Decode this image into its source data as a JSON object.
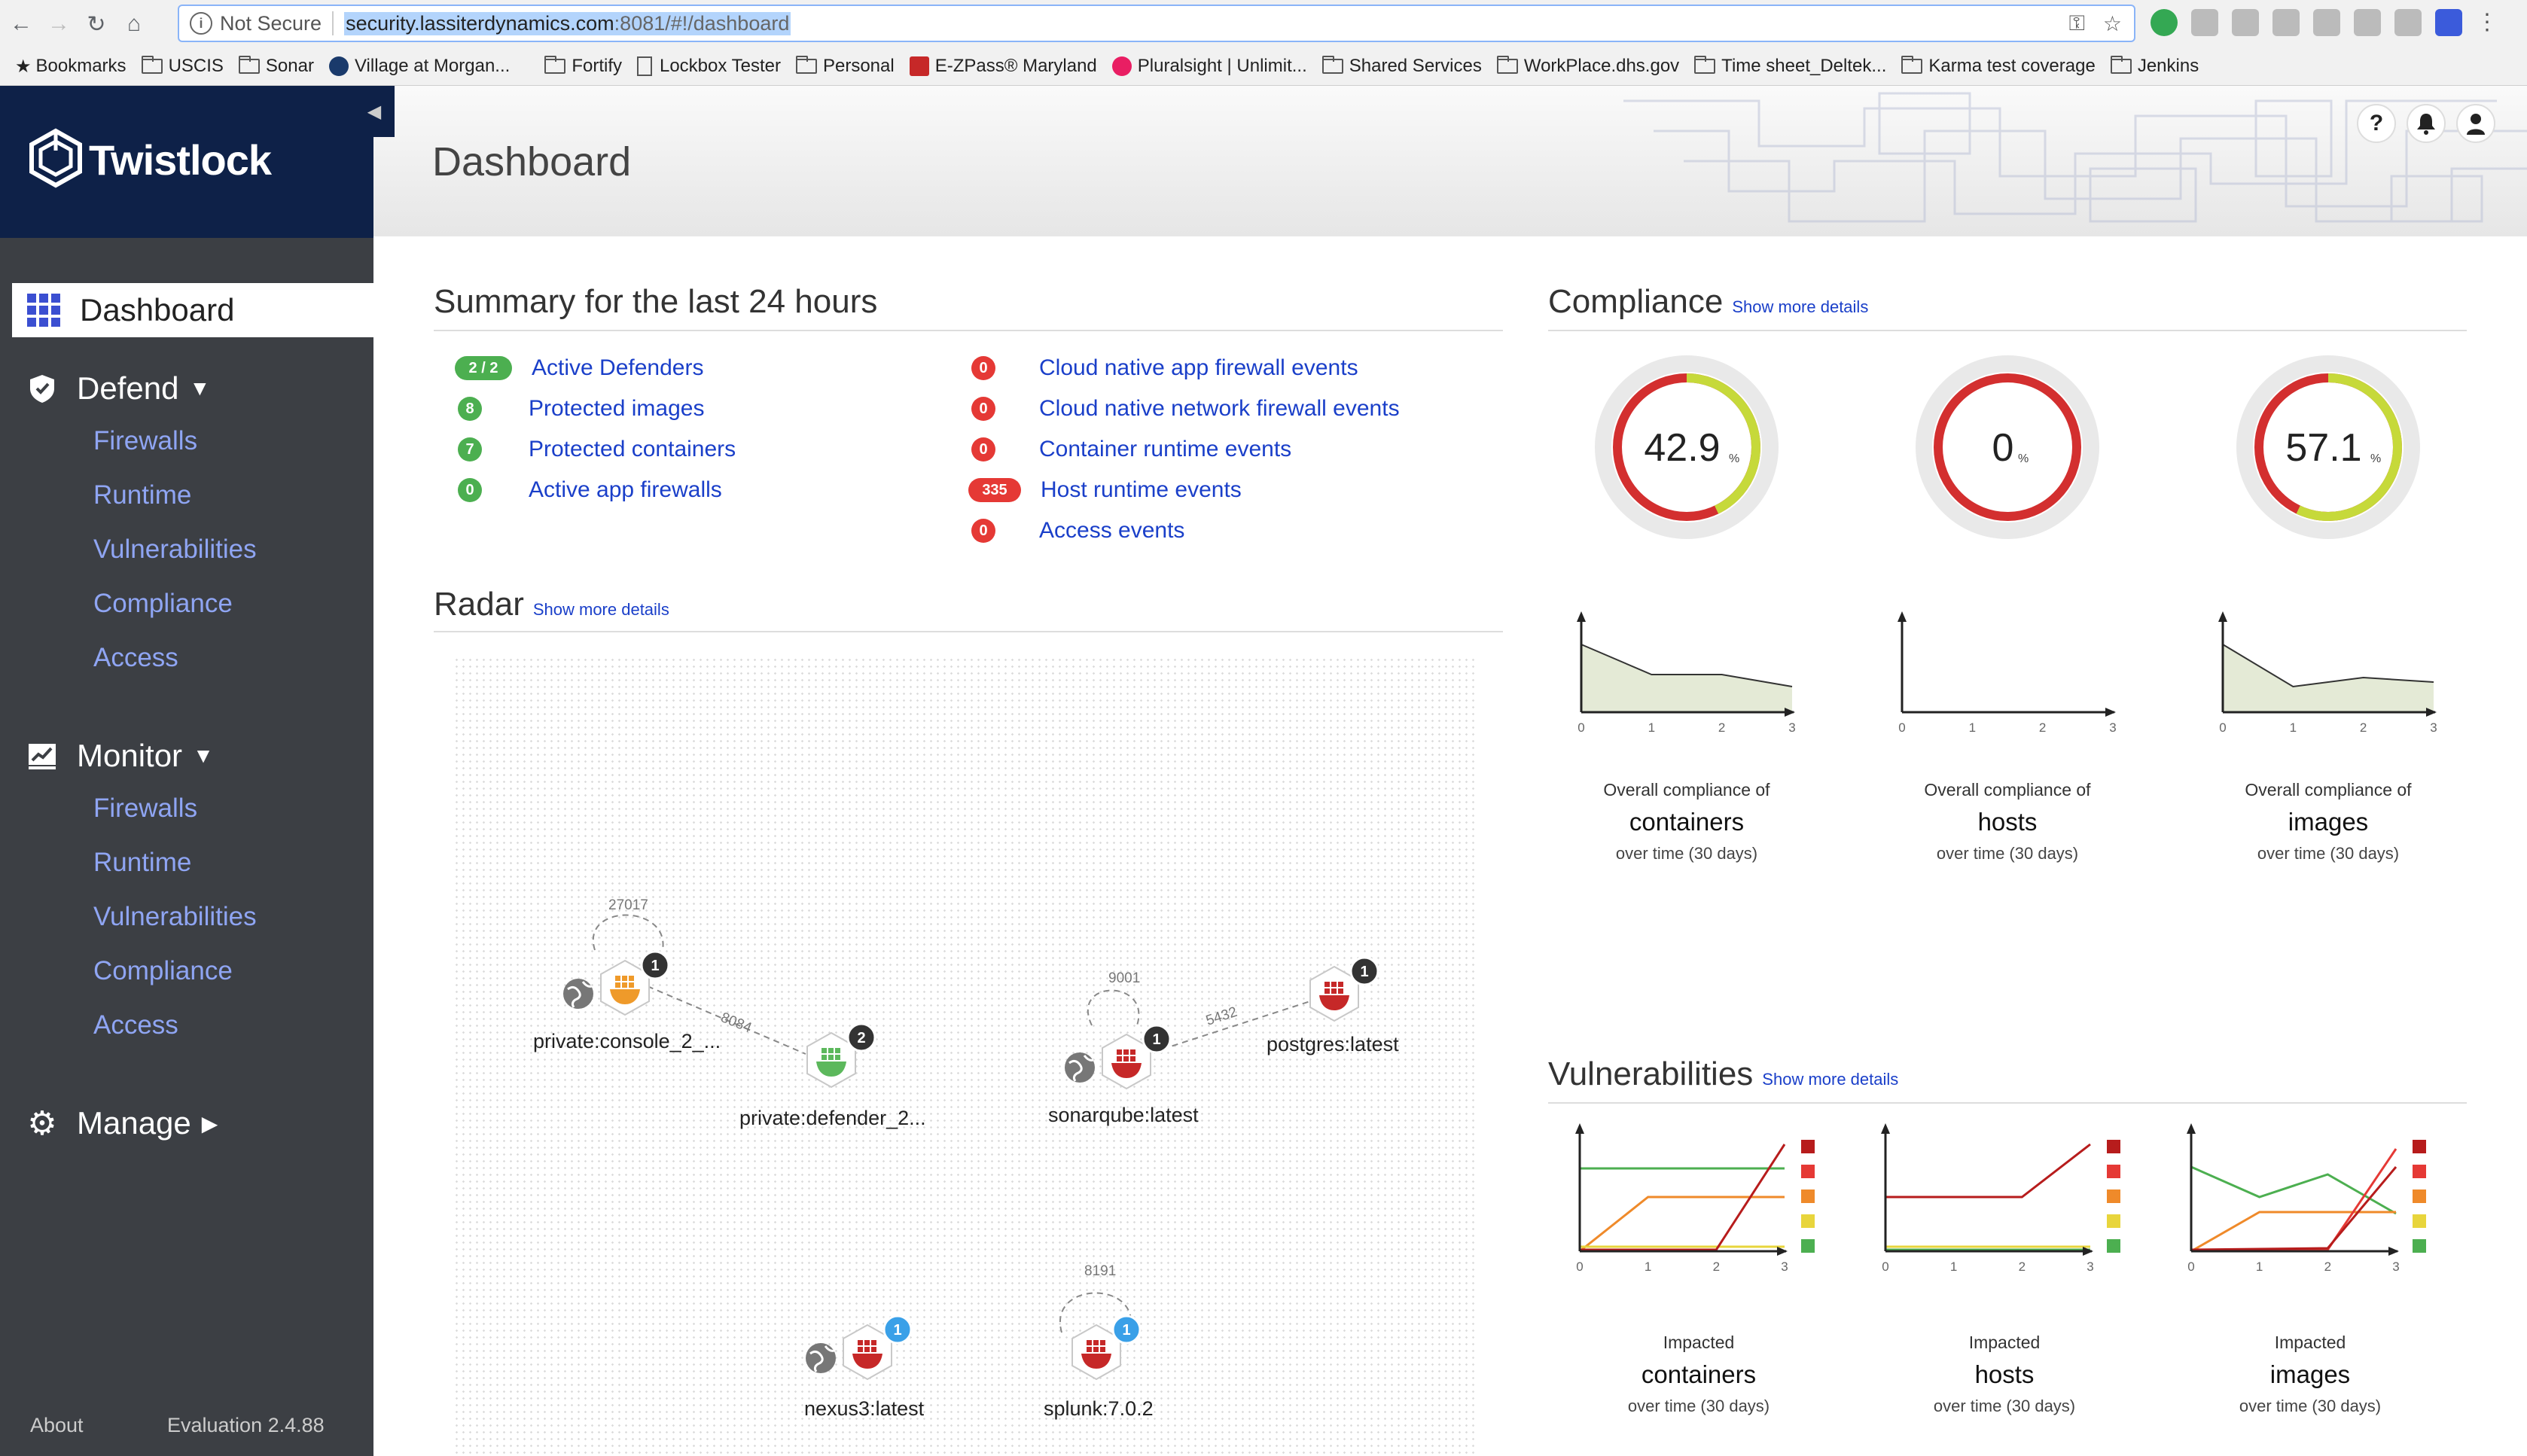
{
  "browser": {
    "security": "Not Secure",
    "url_host": "security.lassiterdynamics.com",
    "url_rest": ":8081/#!/dashboard",
    "bookmarks": [
      "Bookmarks",
      "USCIS",
      "Sonar",
      "Village at Morgan...",
      "Fortify",
      "Lockbox Tester",
      "Personal",
      "E-ZPass® Maryland",
      "Pluralsight | Unlimit...",
      "Shared Services",
      "WorkPlace.dhs.gov",
      "Time sheet_Deltek...",
      "Karma test coverage",
      "Jenkins"
    ]
  },
  "app": {
    "name": "Twistlock",
    "page_title": "Dashboard"
  },
  "sidebar": {
    "dashboard": "Dashboard",
    "defend": {
      "label": "Defend",
      "items": [
        "Firewalls",
        "Runtime",
        "Vulnerabilities",
        "Compliance",
        "Access"
      ]
    },
    "monitor": {
      "label": "Monitor",
      "items": [
        "Firewalls",
        "Runtime",
        "Vulnerabilities",
        "Compliance",
        "Access"
      ]
    },
    "manage": "Manage",
    "about": "About",
    "version": "Evaluation 2.4.88"
  },
  "summary": {
    "title": "Summary for the last 24 hours",
    "left": [
      {
        "count": "2 / 2",
        "label": "Active Defenders",
        "color": "green"
      },
      {
        "count": "8",
        "label": "Protected images",
        "color": "green"
      },
      {
        "count": "7",
        "label": "Protected containers",
        "color": "green"
      },
      {
        "count": "0",
        "label": "Active app firewalls",
        "color": "green"
      }
    ],
    "right": [
      {
        "count": "0",
        "label": "Cloud native app firewall events",
        "color": "red"
      },
      {
        "count": "0",
        "label": "Cloud native network firewall events",
        "color": "red"
      },
      {
        "count": "0",
        "label": "Container runtime events",
        "color": "red"
      },
      {
        "count": "335",
        "label": "Host runtime events",
        "color": "red"
      },
      {
        "count": "0",
        "label": "Access events",
        "color": "red"
      }
    ]
  },
  "radar": {
    "title": "Radar",
    "more": "Show more details",
    "nodes": [
      {
        "label": "private:console_2_...",
        "badge": "1",
        "color": "#ef9a2a"
      },
      {
        "label": "private:defender_2...",
        "badge": "2",
        "color": "#5cb85c"
      },
      {
        "label": "sonarqube:latest",
        "badge": "1",
        "color": "#c62828"
      },
      {
        "label": "postgres:latest",
        "badge": "1",
        "color": "#c62828"
      },
      {
        "label": "nexus3:latest",
        "badge": "1",
        "color": "#c62828"
      },
      {
        "label": "splunk:7.0.2",
        "badge": "1",
        "color": "#c62828"
      }
    ],
    "ports": [
      "27017",
      "8084",
      "9001",
      "5432",
      "8191"
    ]
  },
  "compliance": {
    "title": "Compliance",
    "more": "Show more details",
    "gauges": [
      {
        "value": "42.9",
        "unit": "%",
        "pct": 42.9,
        "a": "Overall compliance of",
        "b": "containers",
        "c": "over time (30 days)"
      },
      {
        "value": "0",
        "unit": "%",
        "pct": 0,
        "a": "Overall compliance of",
        "b": "hosts",
        "c": "over time (30 days)"
      },
      {
        "value": "57.1",
        "unit": "%",
        "pct": 57.1,
        "a": "Overall compliance of",
        "b": "images",
        "c": "over time (30 days)"
      }
    ],
    "ticks": [
      "0",
      "1",
      "2",
      "3"
    ]
  },
  "vulnerabilities": {
    "title": "Vulnerabilities",
    "more": "Show more details",
    "charts": [
      {
        "a": "Impacted",
        "b": "containers",
        "c": "over time (30 days)"
      },
      {
        "a": "Impacted",
        "b": "hosts",
        "c": "over time (30 days)"
      },
      {
        "a": "Impacted",
        "b": "images",
        "c": "over time (30 days)"
      }
    ],
    "ticks": [
      "0",
      "1",
      "2",
      "3"
    ],
    "severity_colors": [
      "#b71c1c",
      "#e53935",
      "#ef8a2a",
      "#e8d53c",
      "#4caf50"
    ]
  },
  "colors": {
    "accent": "#1a3fc9",
    "nav_dark": "#0e2148",
    "sidebar": "#3c3f44",
    "link": "#8fa5f3"
  }
}
